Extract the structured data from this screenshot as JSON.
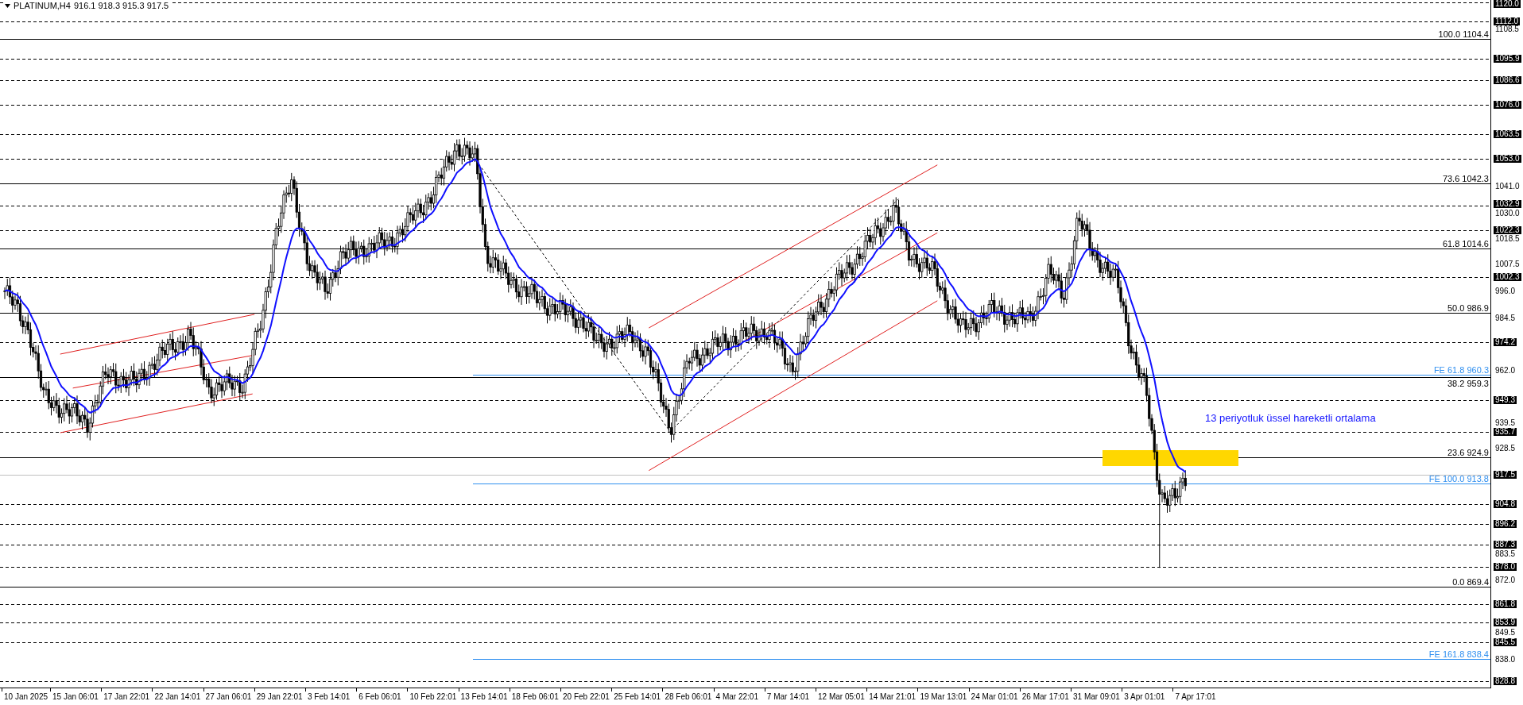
{
  "header": {
    "symbol": "PLATINUM,H4",
    "quote": "916.1 918.3 915.3 917.5"
  },
  "price_axis": [
    {
      "label": "1120.0",
      "kind": "line"
    },
    {
      "label": "1112.0",
      "kind": "line"
    },
    {
      "label": "1108.5",
      "kind": "tick"
    },
    {
      "label": "1095.9",
      "kind": "line"
    },
    {
      "label": "1086.6",
      "kind": "line"
    },
    {
      "label": "1076.0",
      "kind": "line"
    },
    {
      "label": "1063.5",
      "kind": "line"
    },
    {
      "label": "1053.0",
      "kind": "line"
    },
    {
      "label": "1041.0",
      "kind": "tick"
    },
    {
      "label": "1032.9",
      "kind": "line"
    },
    {
      "label": "1030.0",
      "kind": "tick"
    },
    {
      "label": "1022.3",
      "kind": "line"
    },
    {
      "label": "1018.5",
      "kind": "tick"
    },
    {
      "label": "1007.5",
      "kind": "tick"
    },
    {
      "label": "1002.3",
      "kind": "line"
    },
    {
      "label": "996.0",
      "kind": "tick"
    },
    {
      "label": "984.5",
      "kind": "tick"
    },
    {
      "label": "974.2",
      "kind": "line"
    },
    {
      "label": "962.0",
      "kind": "tick"
    },
    {
      "label": "949.3",
      "kind": "line"
    },
    {
      "label": "939.5",
      "kind": "tick"
    },
    {
      "label": "935.7",
      "kind": "line"
    },
    {
      "label": "928.5",
      "kind": "tick"
    },
    {
      "label": "917.5",
      "kind": "current"
    },
    {
      "label": "904.8",
      "kind": "line"
    },
    {
      "label": "896.2",
      "kind": "line"
    },
    {
      "label": "887.3",
      "kind": "line"
    },
    {
      "label": "883.5",
      "kind": "tick"
    },
    {
      "label": "878.0",
      "kind": "line"
    },
    {
      "label": "872.0",
      "kind": "tick"
    },
    {
      "label": "861.8",
      "kind": "line"
    },
    {
      "label": "853.9",
      "kind": "line"
    },
    {
      "label": "849.5",
      "kind": "tick"
    },
    {
      "label": "845.5",
      "kind": "line"
    },
    {
      "label": "838.0",
      "kind": "tick"
    },
    {
      "label": "828.8",
      "kind": "line"
    }
  ],
  "levels": [
    {
      "label": "100.0 1104.4",
      "kind": "fib"
    },
    {
      "label": "73.6 1042.3",
      "kind": "fib"
    },
    {
      "label": "61.8 1014.6",
      "kind": "fib"
    },
    {
      "label": "50.0 986.9",
      "kind": "fib"
    },
    {
      "label": "FE 61.8 960.3",
      "kind": "expansion"
    },
    {
      "label": "38.2 959.3",
      "kind": "fib"
    },
    {
      "label": "23.6 924.9",
      "kind": "fib"
    },
    {
      "label": "FE 100.0 913.8",
      "kind": "expansion"
    },
    {
      "label": "0.0 869.4",
      "kind": "fib"
    },
    {
      "label": "FE 161.8 838.4",
      "kind": "expansion"
    }
  ],
  "note": "13 periyotluk üssel hareketli ortalama",
  "time_axis": [
    "10 Jan 2025",
    "15 Jan 06:01",
    "17 Jan 22:01",
    "22 Jan 14:01",
    "27 Jan 06:01",
    "29 Jan 22:01",
    "3 Feb 14:01",
    "6 Feb 06:01",
    "10 Feb 22:01",
    "13 Feb 14:01",
    "18 Feb 06:01",
    "20 Feb 22:01",
    "25 Feb 14:01",
    "28 Feb 06:01",
    "4 Mar 22:01",
    "7 Mar 14:01",
    "12 Mar 05:01",
    "14 Mar 21:01",
    "19 Mar 13:01",
    "24 Mar 01:01",
    "26 Mar 17:01",
    "31 Mar 09:01",
    "3 Apr 01:01",
    "7 Apr 17:01"
  ]
}
